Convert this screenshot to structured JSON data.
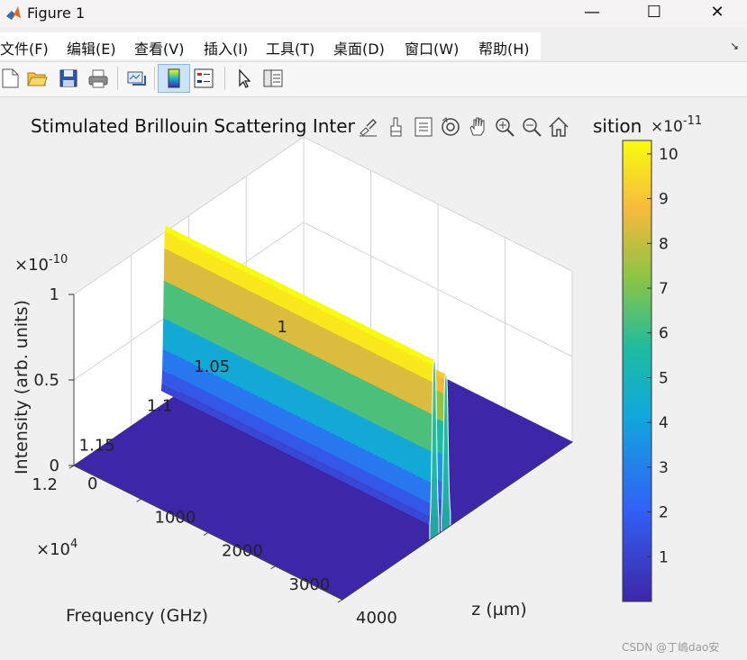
{
  "window": {
    "title": "Figure 1",
    "minimize": "—",
    "maximize": "☐",
    "close": "✕"
  },
  "menu": [
    "文件(F)",
    "编辑(E)",
    "查看(V)",
    "插入(I)",
    "工具(T)",
    "桌面(D)",
    "窗口(W)",
    "帮助(H)"
  ],
  "menu_more": "↘",
  "toolbar_icons": [
    "new-figure-icon",
    "open-file-icon",
    "save-icon",
    "print-icon",
    "link-plot-icon",
    "colorbar-toggle-icon",
    "legend-toggle-icon",
    "pointer-icon",
    "property-inspector-icon"
  ],
  "axes_toolbar_icons": [
    "brush-icon",
    "data-tips-icon",
    "insert-legend-icon",
    "rotate-3d-icon",
    "pan-icon",
    "zoom-in-icon",
    "zoom-out-icon",
    "home-icon"
  ],
  "figure": {
    "title_visible_start": "Stimulated Brillouin Scattering Intensi",
    "title_visible_end": "sition"
  },
  "watermark": "CSDN @丁嶋dao安",
  "colors": {
    "surface_low": "#3a2ab0",
    "surface_high": "#f9fb0e",
    "background": "#f0f0f0"
  },
  "chart_data": {
    "type": "surface",
    "title": "Stimulated Brillouin Scattering Intensi… sition",
    "x": {
      "label": "z (µm)",
      "ticks": [
        "0",
        "1000",
        "2000",
        "3000",
        "4000"
      ],
      "range": [
        0,
        4000
      ]
    },
    "y": {
      "label": "Frequency (GHz)",
      "exponent": "×10^4",
      "ticks": [
        "1",
        "1.05",
        "1.1",
        "1.15",
        "1.2"
      ],
      "range": [
        1.0,
        1.2
      ]
    },
    "z": {
      "label": "Intensity (arb. units)",
      "exponent": "×10^-10",
      "ticks": [
        "0",
        "0.5",
        "1"
      ],
      "range": [
        0,
        1.0
      ]
    },
    "peaks": [
      {
        "frequency": 1.11,
        "intensity": 0.9,
        "z_range": [
          3200,
          4000
        ]
      },
      {
        "frequency": 1.12,
        "intensity": 1.03,
        "z_range": [
          0,
          4000
        ]
      }
    ],
    "colorbar": {
      "exponent": "×10^-11",
      "ticks": [
        "1",
        "2",
        "3",
        "4",
        "5",
        "6",
        "7",
        "8",
        "9",
        "10"
      ],
      "range": [
        0,
        10.3
      ]
    },
    "grid": true
  }
}
